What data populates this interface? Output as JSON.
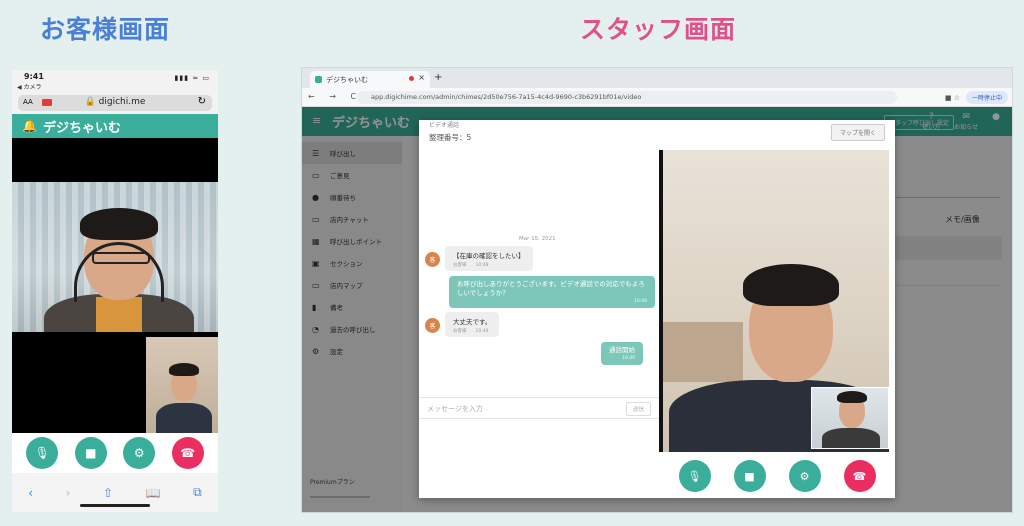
{
  "headings": {
    "customer": "お客様画面",
    "staff": "スタッフ画面"
  },
  "phone": {
    "time": "9:41",
    "back_label": "◀ カメラ",
    "signal": "▮▮▮ ≈ ▭",
    "aa": "AA",
    "domain": "🔒 digichi.me",
    "reload": "↻",
    "brand": "デジちゃいむ",
    "bell_icon": "🔔",
    "controls": {
      "mic": "🎙",
      "video": "■",
      "settings": "⚙",
      "hangup": "☎"
    },
    "safari": {
      "back": "‹",
      "forward": "›",
      "share": "⇧",
      "bookmarks": "📖",
      "tabs": "⧉"
    }
  },
  "browser": {
    "tab_title": "デジちゃいむ",
    "tab_close": "×",
    "new_tab": "+",
    "nav": "← → C",
    "url": "app.digichime.com/admin/chimes/2d50e756-7a15-4c4d-9690-c3b6291bf01e/video",
    "profile": "一時停止中",
    "extensions": "■ ☆"
  },
  "app": {
    "menu_icon": "≡",
    "logo": "デジちゃいむ",
    "header_button": "スタッフ呼び出し設定",
    "header_icons": [
      {
        "icon": "?",
        "label": "使い方"
      },
      {
        "icon": "✉",
        "label": "お知らせ"
      },
      {
        "icon": "●",
        "label": ""
      }
    ],
    "sidebar": [
      {
        "icon": "☰",
        "label": "呼び出し",
        "active": true
      },
      {
        "icon": "▭",
        "label": "ご意見",
        "active": false
      },
      {
        "icon": "●",
        "label": "順番待ち",
        "active": false
      },
      {
        "icon": "▭",
        "label": "店内チャット",
        "active": false
      },
      {
        "icon": "▦",
        "label": "呼び出しポイント",
        "active": false
      },
      {
        "icon": "▣",
        "label": "セクション",
        "active": false
      },
      {
        "icon": "▭",
        "label": "店内マップ",
        "active": false
      },
      {
        "icon": "▮",
        "label": "備考",
        "active": false
      },
      {
        "icon": "◔",
        "label": "過去の呼び出し",
        "active": false
      },
      {
        "icon": "⚙",
        "label": "設定",
        "active": false
      }
    ],
    "premium": "Premiumプラン",
    "memo": "メモ/画像"
  },
  "modal": {
    "title": "ビデオ通話",
    "number": "整理番号：5",
    "map_button": "マップを開く",
    "date": "Mar 15, 2021",
    "messages": [
      {
        "dir": "in",
        "avatar": "客",
        "text": "【在庫の確認をしたい】",
        "meta": "お客様　　10:48"
      },
      {
        "dir": "out",
        "text": "お呼び出しありがとうございます。ビデオ通話での対応でもよろしいでしょうか？",
        "meta": "10:48"
      },
      {
        "dir": "in",
        "avatar": "客",
        "text": "大丈夫です。",
        "meta": "お客様　　10:49"
      },
      {
        "dir": "out",
        "text": "通話開始",
        "meta": "10:49"
      }
    ],
    "input_placeholder": "メッセージを入力",
    "send": "送信",
    "controls": {
      "mic": "🎙",
      "video": "■",
      "settings": "⚙",
      "hangup": "☎"
    }
  }
}
